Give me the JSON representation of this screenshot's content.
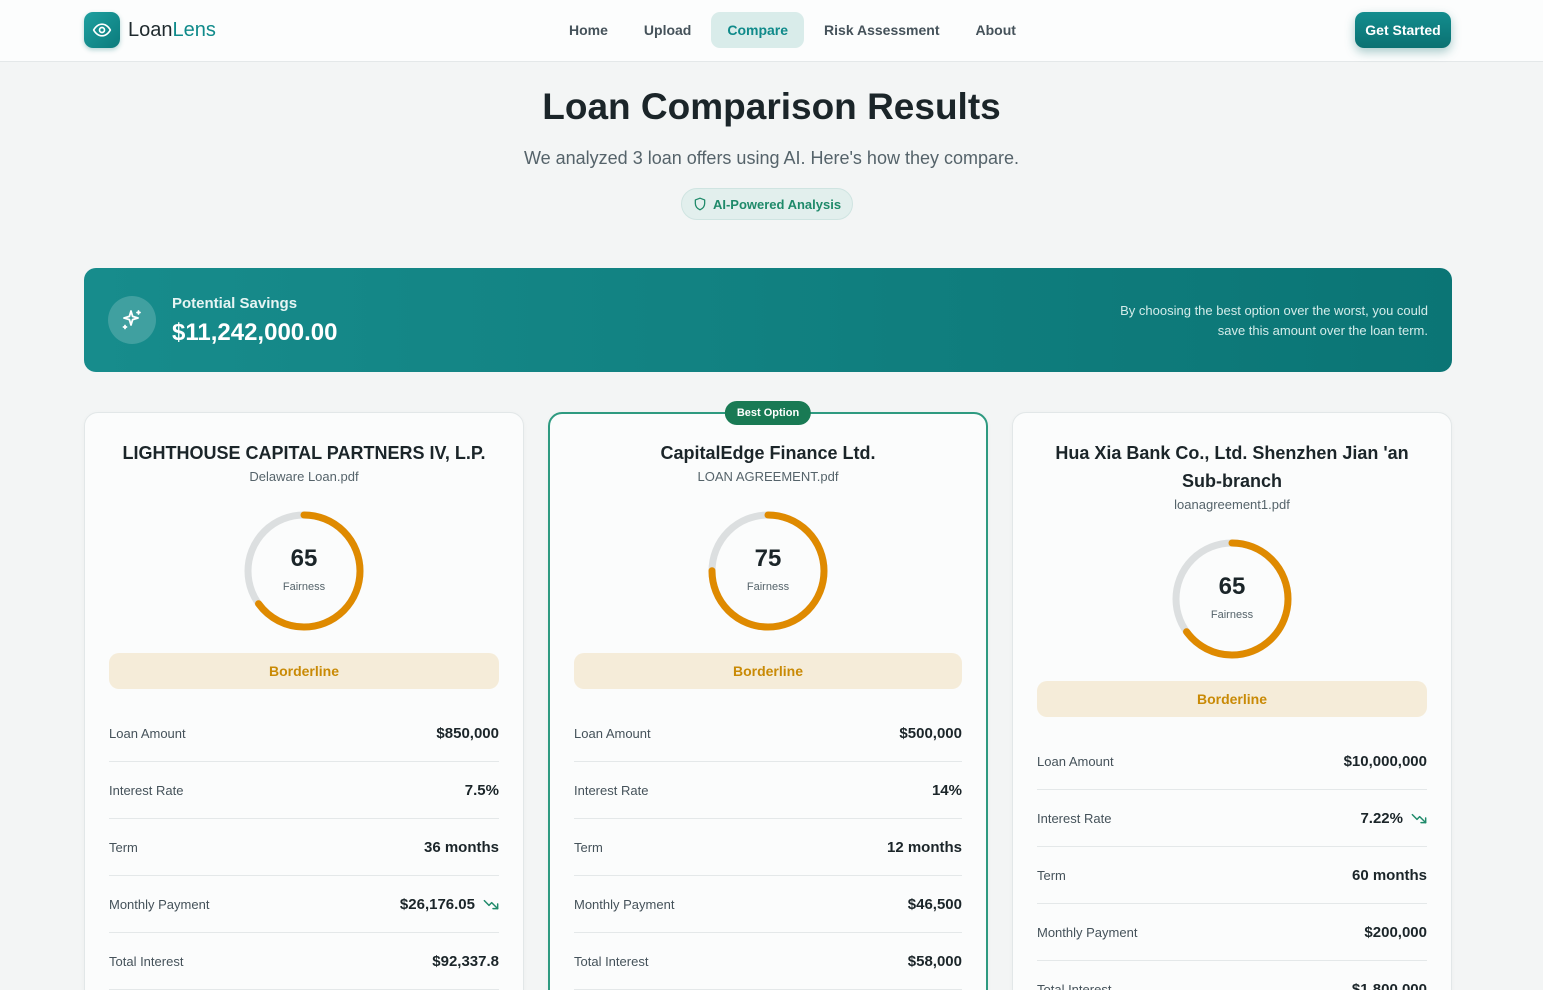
{
  "nav": {
    "logo_prefix": "Loan",
    "logo_accent": "Lens",
    "links": [
      "Home",
      "Upload",
      "Compare",
      "Risk Assessment",
      "About"
    ],
    "active": "Compare",
    "cta": "Get Started"
  },
  "hero": {
    "title": "Loan Comparison Results",
    "subtitle": "We analyzed 3 loan offers using AI. Here's how they compare.",
    "badge": "AI-Powered Analysis"
  },
  "savings": {
    "label": "Potential Savings",
    "amount": "$11,242,000.00",
    "note": "By choosing the best option over the worst, you could save this amount over the loan term."
  },
  "colors": {
    "brand": "#0f8a8a",
    "best_border": "#2e9a80",
    "gauge": "#df8a00",
    "gauge_track": "#dcdfe0",
    "trend": "#1f8a6a"
  },
  "row_labels": {
    "loan_amount": "Loan Amount",
    "interest_rate": "Interest Rate",
    "term": "Term",
    "monthly_payment": "Monthly Payment",
    "total_interest": "Total Interest"
  },
  "cards": [
    {
      "title": "LIGHTHOUSE CAPITAL PARTNERS IV, L.P.",
      "file": "Delaware Loan.pdf",
      "score": 65,
      "score_label": "Fairness",
      "verdict": "Borderline",
      "best": false,
      "loan_amount": "$850,000",
      "interest_rate": "7.5%",
      "term": "36 months",
      "monthly_payment": "$26,176.05",
      "total_interest": "$92,337.8",
      "trend_on": "monthly_payment",
      "trend_icon": "trending-down-icon"
    },
    {
      "title": "CapitalEdge Finance Ltd.",
      "file": "LOAN AGREEMENT.pdf",
      "score": 75,
      "score_label": "Fairness",
      "verdict": "Borderline",
      "best": true,
      "best_label": "Best Option",
      "loan_amount": "$500,000",
      "interest_rate": "14%",
      "term": "12 months",
      "monthly_payment": "$46,500",
      "total_interest": "$58,000",
      "trend_on": ""
    },
    {
      "title": "Hua Xia Bank Co., Ltd. Shenzhen Jian 'an Sub-branch",
      "file": "loanagreement1.pdf",
      "score": 65,
      "score_label": "Fairness",
      "verdict": "Borderline",
      "best": false,
      "loan_amount": "$10,000,000",
      "interest_rate": "7.22%",
      "term": "60 months",
      "monthly_payment": "$200,000",
      "total_interest": "$1,800,000",
      "trend_on": "interest_rate",
      "trend_icon": "trending-down-icon"
    }
  ]
}
